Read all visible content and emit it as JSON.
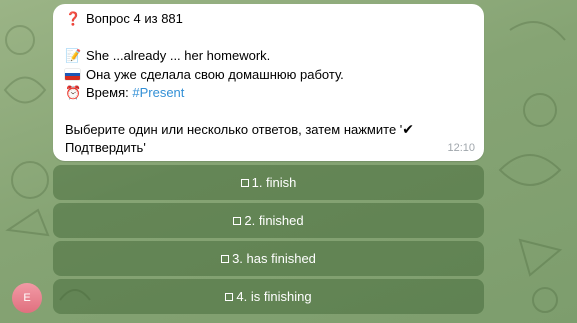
{
  "message": {
    "header": "Вопрос 4 из 881",
    "sentence": "She ...already ... her homework.",
    "translation": "Она уже сделала свою домашнюю работу.",
    "tense_label": "Время:",
    "tense_tag": "#Present",
    "instruction_part1": "Выберите один или несколько ответов, затем нажмите '",
    "instruction_part2": "Подтвердить'",
    "time": "12:10",
    "icons": [
      "question-mark-icon",
      "memo-icon",
      "russia-flag-icon",
      "alarm-clock-icon",
      "check-mark-icon"
    ]
  },
  "keyboard": {
    "buttons": [
      {
        "label": "1. finish"
      },
      {
        "label": "2. finished"
      },
      {
        "label": "3. has finished"
      },
      {
        "label": "4. is finishing"
      }
    ]
  },
  "avatar": {
    "initial": "E"
  },
  "colors": {
    "hashtag": "#3390d6",
    "bubble": "#ffffff",
    "keyboard_button": "#5f7f4f",
    "avatar": "#e8808e",
    "background": "#8aa87a"
  }
}
